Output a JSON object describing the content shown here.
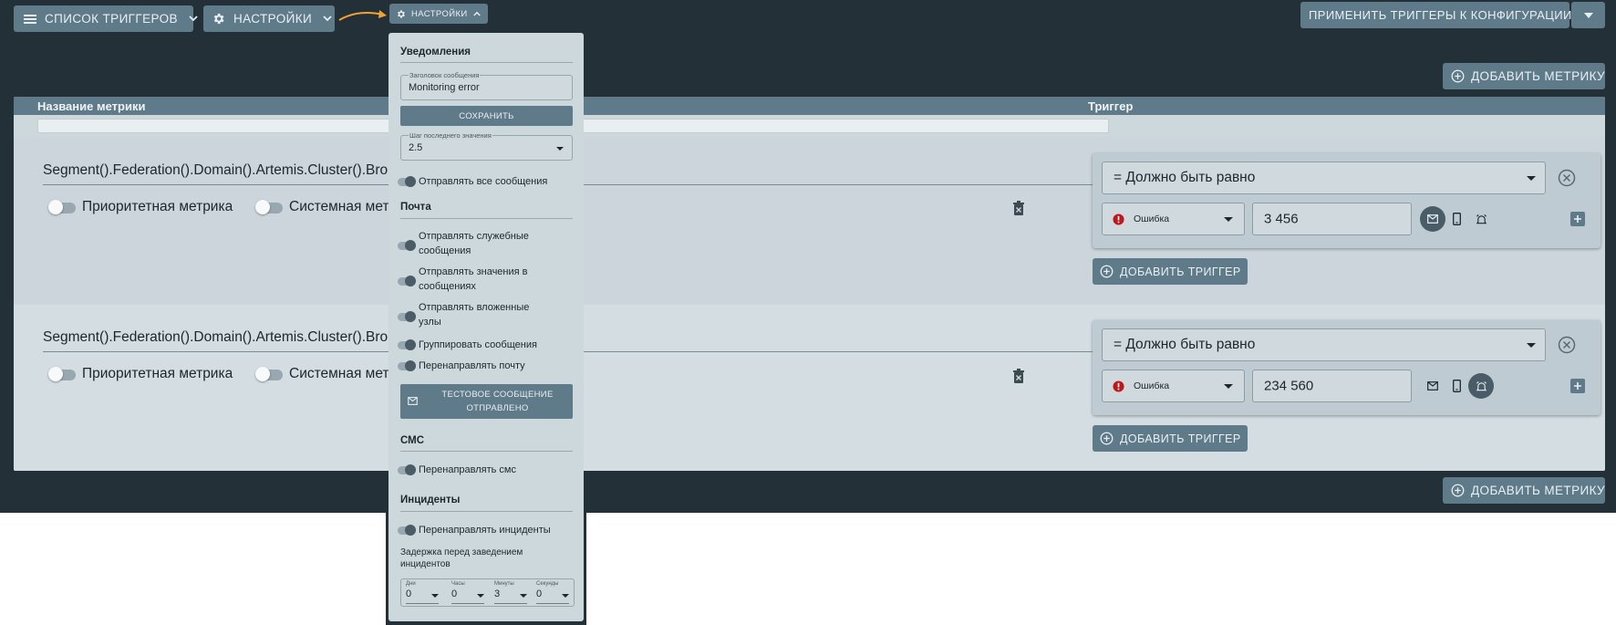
{
  "toolbar": {
    "trigger_list_label": "СПИСОК ТРИГГЕРОВ",
    "settings_label": "НАСТРОЙКИ",
    "settings_small_label": "НАСТРОЙКИ",
    "apply_label": "ПРИМЕНИТЬ ТРИГГЕРЫ К КОНФИГУРАЦИИ",
    "add_metric_label": "ДОБАВИТЬ МЕТРИКУ"
  },
  "table": {
    "col_metric": "Название метрики",
    "col_trigger": "Триггер"
  },
  "metrics": [
    {
      "name": "Segment().Federation().Domain().Artemis.Cluster().Bro",
      "priority_label": "Приоритетная метрика",
      "system_label": "Системная метр",
      "trigger": {
        "condition": "= Должно быть равно",
        "severity": "Ошибка",
        "value": "3 456",
        "active_channel": "email"
      },
      "add_trigger_label": "ДОБАВИТЬ ТРИГГЕР"
    },
    {
      "name": "Segment().Federation().Domain().Artemis.Cluster().Bro",
      "priority_label": "Приоритетная метрика",
      "system_label": "Системная мет",
      "trigger": {
        "condition": "= Должно быть равно",
        "severity": "Ошибка",
        "value": "234 560",
        "active_channel": "incident"
      },
      "add_trigger_label": "ДОБАВИТЬ ТРИГГЕР"
    }
  ],
  "settings_menu": {
    "notifications_heading": "Уведомления",
    "subject_label": "Заголовок сообщения",
    "subject_value": "Monitoring error",
    "save_label": "СОХРАНИТЬ",
    "step_label": "Шаг последнего значения",
    "step_value": "2.5",
    "send_all_label": "Отправлять все сообщения",
    "mail_heading": "Почта",
    "mail_service_1": "Отправлять служебные",
    "mail_service_2": "сообщения",
    "mail_values_1": "Отправлять значения в",
    "mail_values_2": "сообщениях",
    "mail_nested_1": "Отправлять вложенные",
    "mail_nested_2": "узлы",
    "mail_group": "Группировать сообщения",
    "mail_redirect": "Перенаправлять почту",
    "test_msg_1": "ТЕСТОВОЕ СООБЩЕНИЕ",
    "test_msg_2": "ОТПРАВЛЕНО",
    "sms_heading": "СМС",
    "sms_redirect": "Перенаправлять смс",
    "incidents_heading": "Инциденты",
    "incidents_redirect": "Перенаправлять инциденты",
    "delay_1": "Задержка перед заведением",
    "delay_2": "инцидентов",
    "delay": {
      "days_label": "Дни",
      "days_value": "0",
      "hours_label": "Часы",
      "hours_value": "0",
      "minutes_label": "Минуты",
      "minutes_value": "3",
      "seconds_label": "Секунды",
      "seconds_value": "0"
    }
  },
  "colors": {
    "background": "#243038",
    "button": "#5f7a89",
    "panel": "#cdd8dd",
    "error": "#c0161b",
    "accent_arrow": "#f0a233"
  }
}
